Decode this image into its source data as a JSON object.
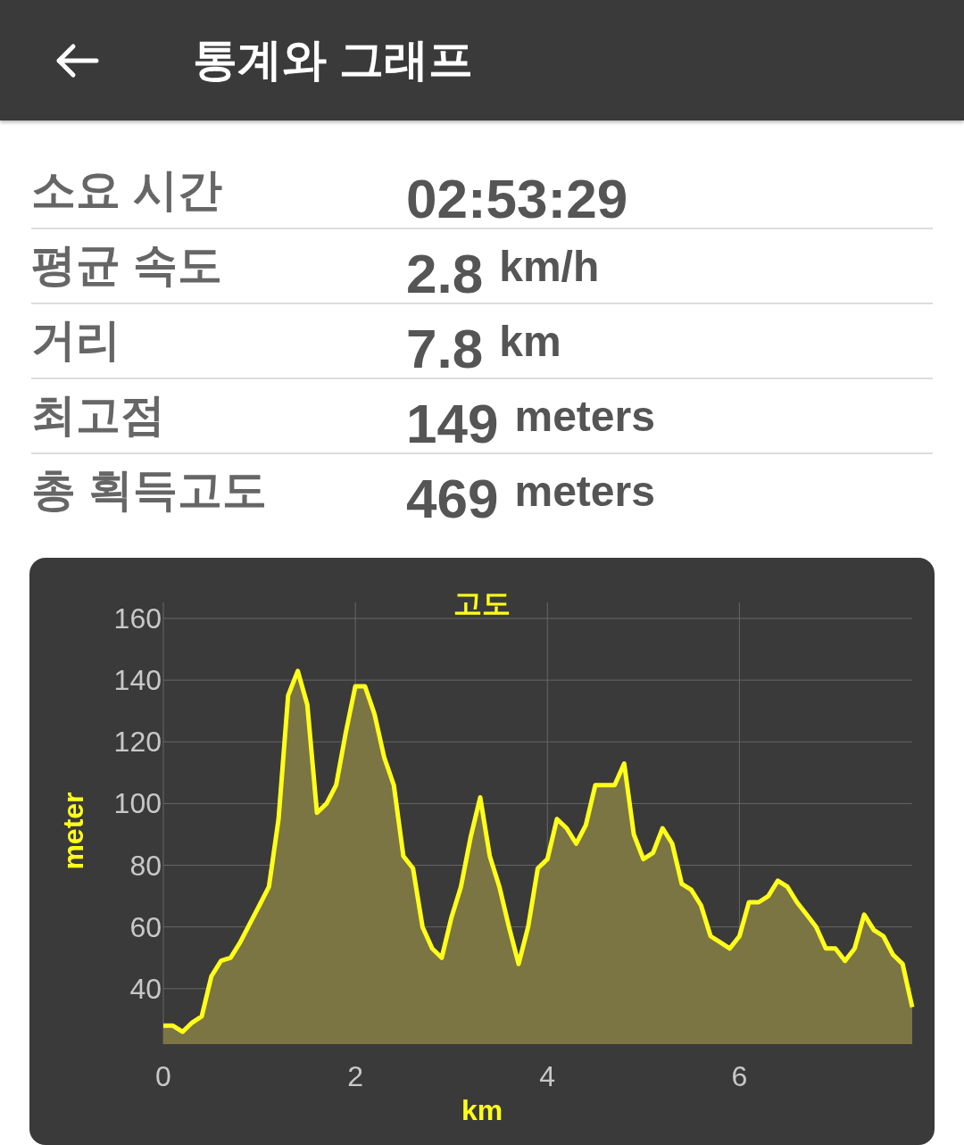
{
  "header": {
    "title": "통계와 그래프"
  },
  "stats": [
    {
      "label": "소요 시간",
      "value": "02:53:29"
    },
    {
      "label": "평균 속도",
      "value": "2.8",
      "unit": "km/h"
    },
    {
      "label": "거리",
      "value": "7.8",
      "unit": "km"
    },
    {
      "label": "최고점",
      "value": "149",
      "unit": "meters"
    },
    {
      "label": "총 획득고도",
      "value": "469",
      "unit": "meters"
    }
  ],
  "chart": {
    "chart_data": {
      "type": "area",
      "title": "고도",
      "xlabel": "km",
      "ylabel": "meter",
      "x": [
        0,
        0.1,
        0.2,
        0.3,
        0.4,
        0.5,
        0.6,
        0.7,
        0.8,
        0.9,
        1,
        1.1,
        1.2,
        1.3,
        1.4,
        1.5,
        1.6,
        1.7,
        1.8,
        1.9,
        2,
        2.1,
        2.2,
        2.3,
        2.4,
        2.5,
        2.6,
        2.7,
        2.8,
        2.9,
        3,
        3.1,
        3.2,
        3.3,
        3.4,
        3.5,
        3.6,
        3.7,
        3.8,
        3.9,
        4,
        4.1,
        4.2,
        4.3,
        4.4,
        4.5,
        4.6,
        4.7,
        4.8,
        4.9,
        5,
        5.1,
        5.2,
        5.3,
        5.4,
        5.5,
        5.6,
        5.7,
        5.8,
        5.9,
        6,
        6.1,
        6.2,
        6.3,
        6.4,
        6.5,
        6.6,
        6.7,
        6.8,
        6.9,
        7,
        7.1,
        7.2,
        7.3,
        7.4,
        7.5,
        7.6,
        7.7,
        7.8
      ],
      "series": [
        {
          "color": "#ffff1a",
          "values": [
            28,
            28,
            26,
            29,
            31,
            44,
            49,
            50,
            55,
            61,
            67,
            73,
            95,
            135,
            143,
            132,
            97,
            100,
            106,
            123,
            138,
            138,
            129,
            115,
            106,
            83,
            79,
            60,
            53,
            50,
            63,
            73,
            89,
            102,
            83,
            73,
            60,
            48,
            60,
            79,
            82,
            95,
            92,
            87,
            93,
            106,
            106,
            106,
            113,
            90,
            82,
            84,
            92,
            87,
            74,
            72,
            67,
            57,
            55,
            53,
            57,
            68,
            68,
            70,
            75,
            73,
            68,
            64,
            60,
            53,
            53,
            49,
            53,
            64,
            59,
            57,
            51,
            48,
            34
          ]
        }
      ],
      "grid": true,
      "xlim": [
        0,
        7.8
      ],
      "ylim": [
        22,
        160
      ],
      "xticks": [
        0,
        2,
        4,
        6
      ],
      "yticks": [
        40,
        60,
        80,
        100,
        120,
        140,
        160
      ]
    }
  }
}
